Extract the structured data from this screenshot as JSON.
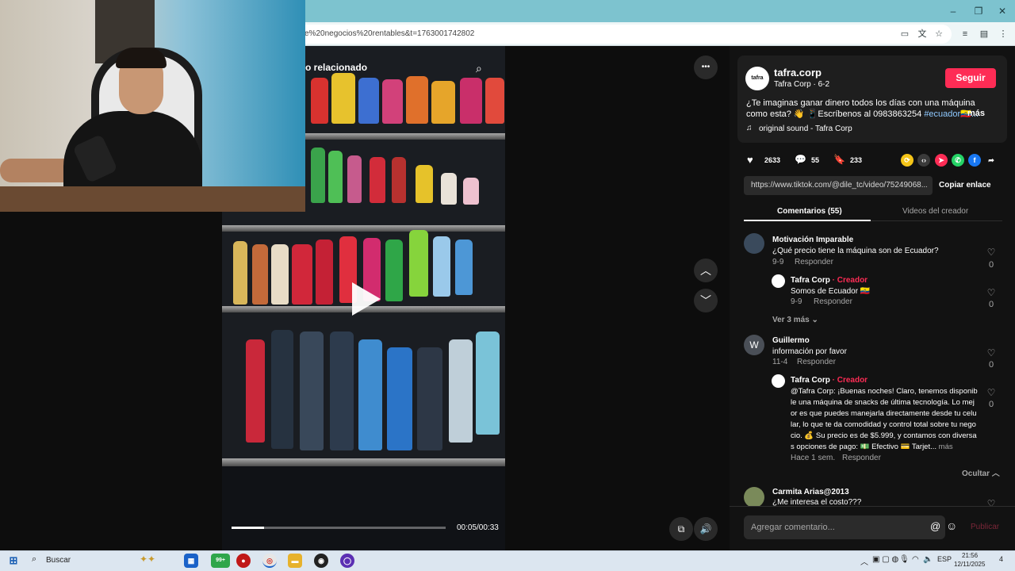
{
  "browser": {
    "url": "e%20negocios%20rentables&t=1763001742802",
    "window_controls": [
      "–",
      "❐",
      "✕"
    ],
    "toolbar_icons": [
      "cast-icon",
      "translate-icon",
      "star-icon",
      "tab-search-icon",
      "sidebar-icon",
      "menu-icon"
    ]
  },
  "video": {
    "header_label": "o relacionado",
    "time": "00:05/00:33",
    "progress": 0.15,
    "more_glyph": "•••",
    "up_glyph": "︿",
    "down_glyph": "﹀"
  },
  "post": {
    "author_handle": "tafra.corp",
    "author_name": "Tafra Corp · 6-2",
    "logo_text": "tafra corp",
    "follow_label": "Seguir",
    "caption": "¿Te imaginas ganar dinero todos los días con una máquina como esta? 👋 📱Escríbenos al 0983863254 ",
    "caption_hashtag": "#ecuador🇪🇨...",
    "more_label": "más",
    "music": "original sound - Tafra Corp",
    "likes": "2633",
    "comments": "55",
    "saves": "233",
    "link": "https://www.tiktok.com/@dile_tc/video/75249068...",
    "copy_label": "Copiar enlace"
  },
  "tabs": {
    "comments": "Comentarios (55)",
    "creator_videos": "Videos del creador"
  },
  "comments": [
    {
      "user": "Motivación Imparable",
      "text": "¿Qué precio tiene la máquina son de Ecuador?",
      "date": "9-9",
      "reply": "Responder",
      "likes": "0"
    },
    {
      "user": "Tafra Corp",
      "badge": "· Creador",
      "text": "Somos de Ecuador 🇪🇨",
      "date": "9-9",
      "reply": "Responder",
      "likes": "0"
    },
    {
      "user": "Guillermo",
      "avatar_letter": "W",
      "text": "información por favor",
      "date": "11-4",
      "reply": "Responder",
      "likes": "0"
    },
    {
      "user": "Tafra Corp",
      "badge": "· Creador",
      "text": "@Tafra Corp: ¡Buenas noches! Claro, tenemos disponible una máquina de snacks de última tecnología. Lo mejor es que puedes manejarla directamente desde tu celular, lo que te da comodidad y control total sobre tu negocio. 💰 Su precio es de $5.999, y contamos con diversas opciones de pago: 💵 Efectivo 💳 Tarjet...",
      "more": "más",
      "date": "Hace 1 sem.",
      "reply": "Responder",
      "likes": "0"
    },
    {
      "user": "Carmita Arias@2013",
      "text": "¿Me interesa el costo???"
    }
  ],
  "view_more": "Ver 3 más",
  "hide": "Ocultar",
  "comment_input": {
    "placeholder": "Agregar comentario...",
    "post_label": "Publicar"
  },
  "taskbar": {
    "search_placeholder": "Buscar",
    "badge": "99+",
    "lang": "ESP",
    "time": "21:56",
    "date": "12/11/2025",
    "notif_count": "4"
  },
  "colors": {
    "accent": "#fe2c55",
    "hashtag": "#8fc9ff",
    "panel_bg": "#121212"
  }
}
